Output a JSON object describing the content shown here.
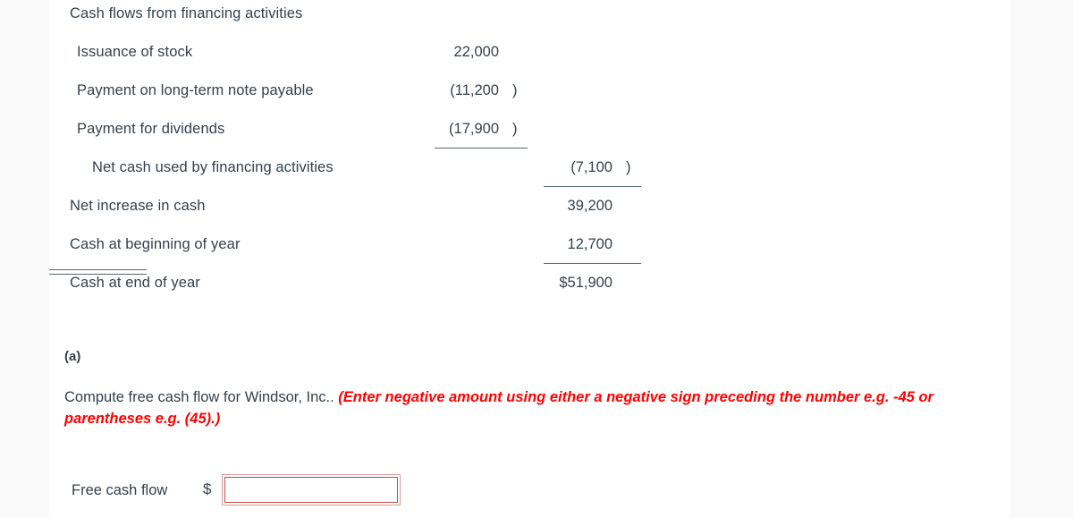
{
  "statement": {
    "rows": [
      {
        "label": "Cash flows from financing activities",
        "indent": 0,
        "col1": "",
        "col1_paren": "",
        "col2": "",
        "col2_paren": "",
        "rule": "none"
      },
      {
        "label": "Issuance of stock",
        "indent": 1,
        "col1": "22,000",
        "col1_paren": "",
        "col2": "",
        "col2_paren": "",
        "rule": "none"
      },
      {
        "label": "Payment on long-term note payable",
        "indent": 1,
        "col1": "(11,200",
        "col1_paren": ")",
        "col2": "",
        "col2_paren": "",
        "rule": "none"
      },
      {
        "label": "Payment for dividends",
        "indent": 1,
        "col1": "(17,900",
        "col1_paren": ")",
        "col2": "",
        "col2_paren": "",
        "rule": "col1"
      },
      {
        "label": "Net cash used by financing activities",
        "indent": 2,
        "col1": "",
        "col1_paren": "",
        "col2": "(7,100",
        "col2_paren": ")",
        "rule": "col2"
      },
      {
        "label": "Net increase in cash",
        "indent": 0,
        "col1": "",
        "col1_paren": "",
        "col2": "39,200",
        "col2_paren": "",
        "rule": "none"
      },
      {
        "label": "Cash at beginning of year",
        "indent": 0,
        "col1": "",
        "col1_paren": "",
        "col2": "12,700",
        "col2_paren": "",
        "rule": "col2"
      },
      {
        "label": "Cash at end of year",
        "indent": 0,
        "col1": "",
        "col1_paren": "",
        "col2": "$51,900",
        "col2_paren": "",
        "rule": "double"
      }
    ]
  },
  "question": {
    "part_label": "(a)",
    "prompt_text": "Compute free cash flow for Windsor, Inc..",
    "hint_text": " (Enter negative amount using either a negative sign preceding the number e.g. -45 or parentheses e.g. (45).)"
  },
  "answer": {
    "label": "Free cash flow",
    "currency_symbol": "$",
    "value": "",
    "placeholder": ""
  },
  "colors": {
    "text": "#33414d",
    "hint_red": "#ff0000",
    "rule": "#5b6770",
    "input_border_inner": "#c0504d",
    "input_border_outer": "#d89a99",
    "page_band": "#f9f9fa",
    "sheet": "#ffffff"
  }
}
